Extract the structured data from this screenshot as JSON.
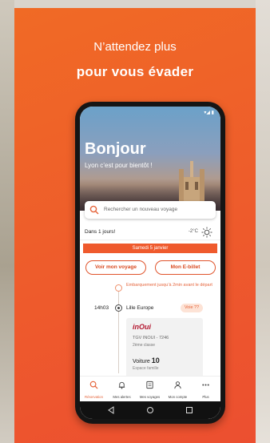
{
  "tagline": {
    "line1": "N’attendez plus",
    "line2": "pour vous évader"
  },
  "phone": {
    "hero": {
      "title": "Bonjour",
      "subtitle": "Lyon c’est pour bientôt !"
    },
    "search": {
      "placeholder": "Rechercher un nouveau voyage",
      "icon": "search-icon"
    },
    "trip": {
      "countdown": "Dans 1 jours!",
      "temperature": "-2°C",
      "weather_icon": "sun-icon",
      "date": "Samedi 5 janvier",
      "buttons": {
        "view": "Voir mon voyage",
        "ticket": "Mon E-billet"
      },
      "boarding_note": "Embarquement jusqu’à 2min avant le départ",
      "departure_time": "14h03",
      "station": "Lille Europe",
      "voie": "Voie ??",
      "operator": "inOui",
      "train": "TGV INOUI - 7246",
      "class": "2ème classe",
      "coach_label": "Voiture",
      "coach_number": "10",
      "coach_note": "Espace famille"
    },
    "nav": [
      {
        "label": "Réservation",
        "icon": "search-icon",
        "active": true
      },
      {
        "label": "Mes alertes",
        "icon": "bell-icon",
        "active": false
      },
      {
        "label": "Mes voyages",
        "icon": "ticket-icon",
        "active": false
      },
      {
        "label": "Mon compte",
        "icon": "user-icon",
        "active": false
      },
      {
        "label": "Plus",
        "icon": "more-icon",
        "active": false
      }
    ]
  },
  "colors": {
    "brand": "#EE5B2C",
    "inoui": "#B3142D"
  }
}
